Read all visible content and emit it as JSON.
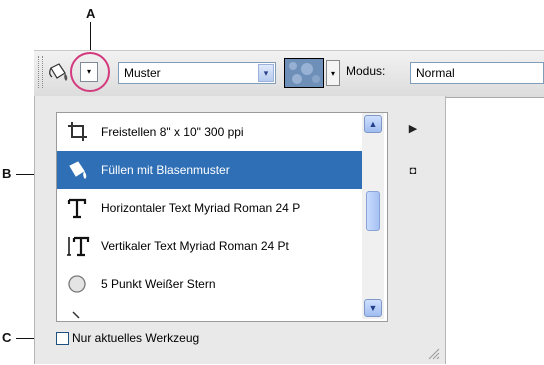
{
  "callouts": {
    "a": "A",
    "b": "B",
    "c": "C"
  },
  "toolbar": {
    "preset_button_glyph": "▾",
    "pattern_source": {
      "value": "Muster",
      "arrow": "▾"
    },
    "pattern_picker_arrow": "▾",
    "mode": {
      "label": "Modus:",
      "value": "Normal",
      "arrow": "▾"
    }
  },
  "preset_list": {
    "items": [
      {
        "label": "Freistellen 8\" x 10\" 300 ppi",
        "icon": "crop-icon",
        "selected": false
      },
      {
        "label": "Füllen mit Blasenmuster",
        "icon": "paint-bucket-icon",
        "selected": true
      },
      {
        "label": "Horizontaler Text Myriad Roman 24 P",
        "icon": "horizontal-type-icon",
        "selected": false
      },
      {
        "label": "Vertikaler Text Myriad Roman 24 Pt",
        "icon": "vertical-type-icon",
        "selected": false
      },
      {
        "label": "5 Punkt Weißer Stern",
        "icon": "star-shape-icon",
        "selected": false
      },
      {
        "label": "",
        "icon": "partial-icon",
        "selected": false
      }
    ],
    "scroll_up": "▲",
    "scroll_down": "▼"
  },
  "panel_menu_glyph": "▶",
  "panel_new_preset_glyph": "◘",
  "current_tool_only": {
    "label": "Nur aktuelles Werkzeug",
    "checked": false
  },
  "colors": {
    "selection": "#2f6fb6",
    "callout_ring": "#d33a7e",
    "field_border": "#7f9db9"
  }
}
